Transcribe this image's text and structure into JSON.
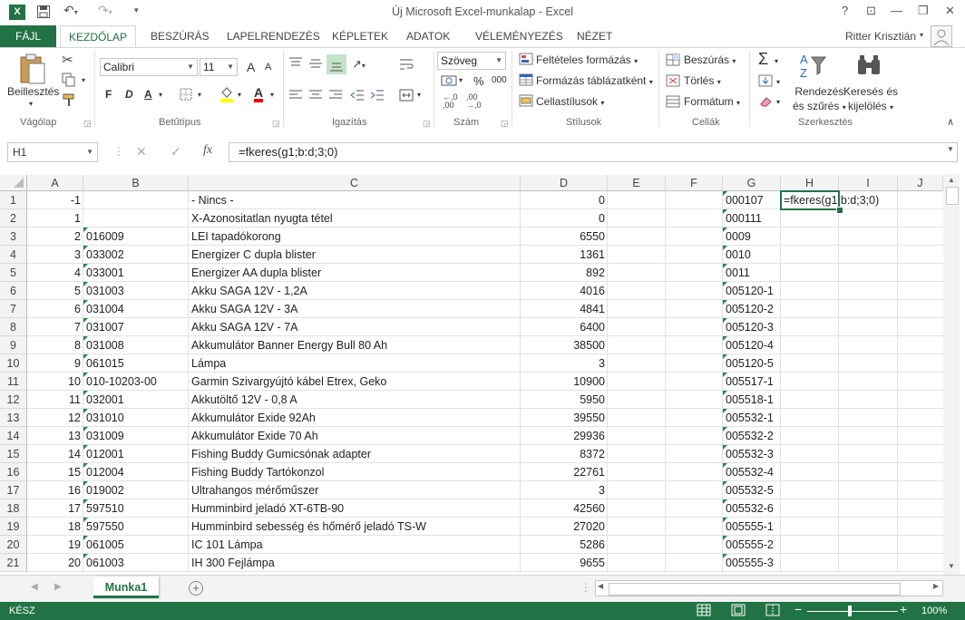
{
  "window": {
    "title": "Új Microsoft Excel-munkalap - Excel",
    "help_label": "?",
    "minimize_label": "—",
    "restore_label": "❐",
    "close_label": "✕",
    "ribbon_display_label": "⊡",
    "user_name": "Ritter Krisztián"
  },
  "tabs": [
    "FÁJL",
    "KEZDŐLAP",
    "BESZÚRÁS",
    "LAPELRENDEZÉS",
    "KÉPLETEK",
    "ADATOK",
    "VÉLEMÉNYEZÉS",
    "NÉZET"
  ],
  "ribbon": {
    "clipboard": {
      "paste_label": "Beillesztés",
      "group_label": "Vágólap"
    },
    "font": {
      "font_name": "Calibri",
      "font_size": "11",
      "group_label": "Betűtípus",
      "bold": "F",
      "italic": "D",
      "underline": "A",
      "font_color": "A",
      "grow": "A",
      "shrink": "A"
    },
    "alignment": {
      "group_label": "Igazítás"
    },
    "number": {
      "format": "Szöveg",
      "percent": "%",
      "thousands": "000",
      "group_label": "Szám"
    },
    "styles": {
      "conditional": "Feltételes formázás",
      "as_table": "Formázás táblázatként",
      "cell_styles": "Cellastílusok",
      "group_label": "Stílusok"
    },
    "cells": {
      "insert": "Beszúrás",
      "delete": "Törlés",
      "format": "Formátum",
      "group_label": "Cellák"
    },
    "editing": {
      "sort_line1": "Rendezés",
      "sort_line2": "és szűrés",
      "find_line1": "Keresés és",
      "find_line2": "kijelölés",
      "group_label": "Szerkesztés",
      "autosum": "Σ"
    }
  },
  "formula_bar": {
    "name_box": "H1",
    "cancel": "✕",
    "enter": "✓",
    "fx": "fx",
    "formula": "=fkeres(g1;b:d;3;0)"
  },
  "columns": [
    "A",
    "B",
    "C",
    "D",
    "E",
    "F",
    "G",
    "H",
    "I",
    "J"
  ],
  "rows": [
    {
      "n": "1",
      "a": "-1",
      "b": "",
      "c": " - Nincs -",
      "d": "0",
      "g": "000107",
      "h": "=fkeres(g1;b:d;3;0)"
    },
    {
      "n": "2",
      "a": "1",
      "b": "",
      "c": "X-Azonositatlan nyugta tétel",
      "d": "0",
      "g": "000111",
      "h": ""
    },
    {
      "n": "3",
      "a": "2",
      "b": "016009",
      "c": "LEI tapadókorong",
      "d": "6550",
      "g": "0009",
      "h": ""
    },
    {
      "n": "4",
      "a": "3",
      "b": "033002",
      "c": "Energizer C dupla blister",
      "d": "1361",
      "g": "0010",
      "h": ""
    },
    {
      "n": "5",
      "a": "4",
      "b": "033001",
      "c": "Energizer AA dupla blister",
      "d": "892",
      "g": "0011",
      "h": ""
    },
    {
      "n": "6",
      "a": "5",
      "b": "031003",
      "c": "Akku SAGA 12V - 1,2A",
      "d": "4016",
      "g": "005120-1",
      "h": ""
    },
    {
      "n": "7",
      "a": "6",
      "b": "031004",
      "c": "Akku SAGA 12V - 3A",
      "d": "4841",
      "g": "005120-2",
      "h": ""
    },
    {
      "n": "8",
      "a": "7",
      "b": "031007",
      "c": "Akku SAGA 12V - 7A",
      "d": "6400",
      "g": "005120-3",
      "h": ""
    },
    {
      "n": "9",
      "a": "8",
      "b": "031008",
      "c": "Akkumulátor Banner Energy Bull 80 Ah",
      "d": "38500",
      "g": "005120-4",
      "h": ""
    },
    {
      "n": "10",
      "a": "9",
      "b": "061015",
      "c": "Lámpa",
      "d": "3",
      "g": "005120-5",
      "h": ""
    },
    {
      "n": "11",
      "a": "10",
      "b": "010-10203-00",
      "c": "Garmin Szivargyújtó kábel Etrex, Geko",
      "d": "10900",
      "g": "005517-1",
      "h": ""
    },
    {
      "n": "12",
      "a": "11",
      "b": "032001",
      "c": "Akkutöltő 12V - 0,8 A",
      "d": "5950",
      "g": "005518-1",
      "h": ""
    },
    {
      "n": "13",
      "a": "12",
      "b": "031010",
      "c": "Akkumulátor Exide 92Ah",
      "d": "39550",
      "g": "005532-1",
      "h": ""
    },
    {
      "n": "14",
      "a": "13",
      "b": "031009",
      "c": "Akkumulátor Exide 70 Ah",
      "d": "29936",
      "g": "005532-2",
      "h": ""
    },
    {
      "n": "15",
      "a": "14",
      "b": "012001",
      "c": "Fishing Buddy Gumicsónak adapter",
      "d": "8372",
      "g": "005532-3",
      "h": ""
    },
    {
      "n": "16",
      "a": "15",
      "b": "012004",
      "c": "Fishing Buddy Tartókonzol",
      "d": "22761",
      "g": "005532-4",
      "h": ""
    },
    {
      "n": "17",
      "a": "16",
      "b": "019002",
      "c": "Ultrahangos mérőműszer",
      "d": "3",
      "g": "005532-5",
      "h": ""
    },
    {
      "n": "18",
      "a": "17",
      "b": "597510",
      "c": "Humminbird jeladó XT-6TB-90",
      "d": "42560",
      "g": "005532-6",
      "h": ""
    },
    {
      "n": "19",
      "a": "18",
      "b": "597550",
      "c": "Humminbird sebesség és hőmérő jeladó TS-W",
      "d": "27020",
      "g": "005555-1",
      "h": ""
    },
    {
      "n": "20",
      "a": "19",
      "b": "061005",
      "c": "IC 101 Lámpa",
      "d": "5286",
      "g": "005555-2",
      "h": ""
    },
    {
      "n": "21",
      "a": "20",
      "b": "061003",
      "c": "IH 300 Fejlámpa",
      "d": "9655",
      "g": "005555-3",
      "h": ""
    }
  ],
  "sheets": [
    "Munka1"
  ],
  "status": {
    "ready": "KÉSZ",
    "zoom": "100%"
  },
  "colors": {
    "accent": "#217346",
    "marker": "#1e8c3b"
  }
}
